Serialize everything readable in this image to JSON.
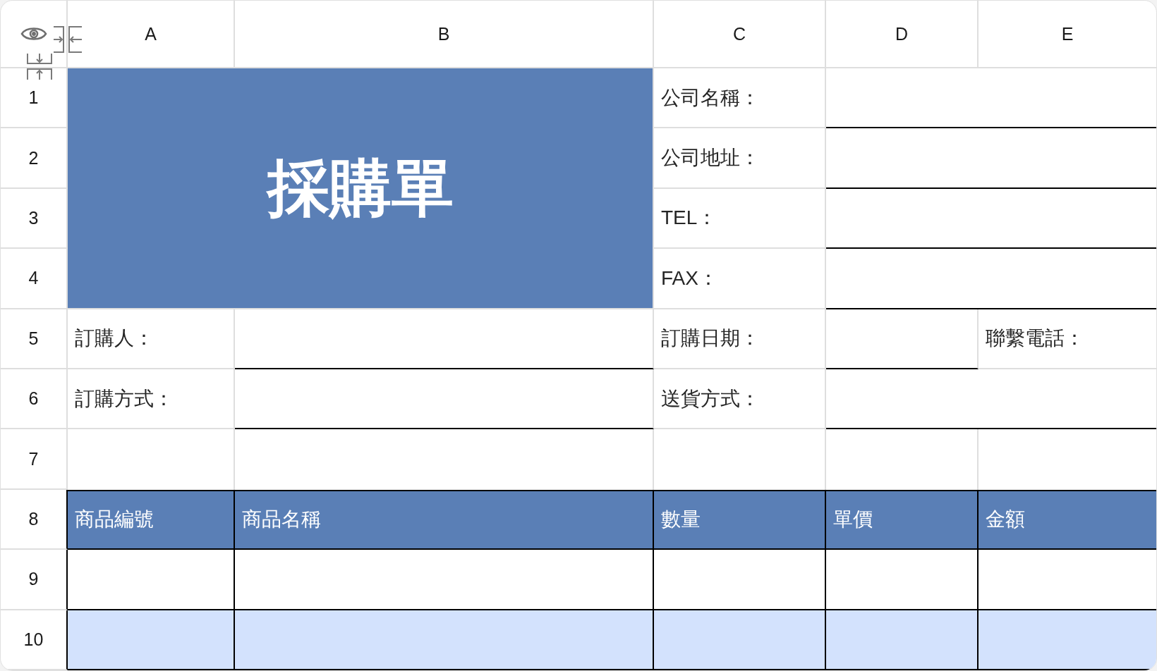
{
  "sheet": {
    "column_headers": [
      "A",
      "B",
      "C",
      "D",
      "E"
    ],
    "row_headers": [
      "1",
      "2",
      "3",
      "4",
      "5",
      "6",
      "7",
      "8",
      "9",
      "10"
    ],
    "title": "採購單",
    "company_fields": [
      "公司名稱：",
      "公司地址：",
      "TEL：",
      "FAX："
    ],
    "order_rows": [
      [
        {
          "kind": "label",
          "text": "訂購人："
        },
        {
          "kind": "blank"
        },
        {
          "kind": "label",
          "text": "訂購日期："
        },
        {
          "kind": "blank"
        },
        {
          "kind": "label",
          "text": "聯繫電話："
        }
      ],
      [
        {
          "kind": "label",
          "text": "訂購方式："
        },
        {
          "kind": "blank"
        },
        {
          "kind": "label",
          "text": "送貨方式："
        },
        {
          "kind": "blank"
        }
      ]
    ],
    "items_table": {
      "columns": [
        "商品編號",
        "商品名稱",
        "數量",
        "單價",
        "金額"
      ],
      "rows": [
        {
          "shaded": false
        },
        {
          "shaded": true
        }
      ]
    }
  }
}
